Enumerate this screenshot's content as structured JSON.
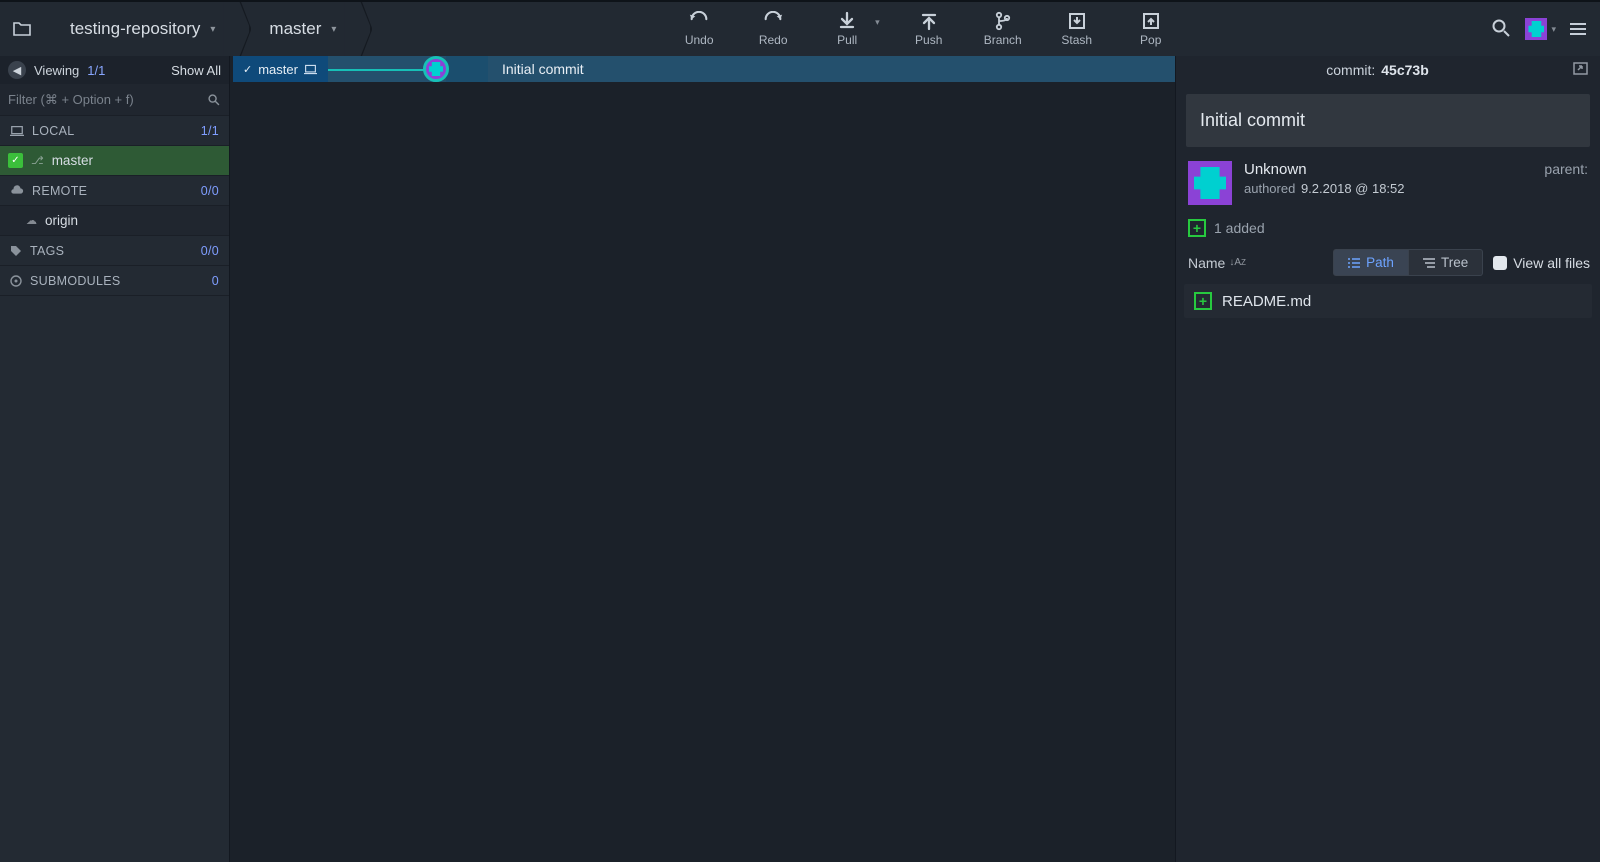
{
  "breadcrumb": {
    "repo": "testing-repository",
    "branch": "master"
  },
  "toolbar": {
    "undo": "Undo",
    "redo": "Redo",
    "pull": "Pull",
    "push": "Push",
    "branch": "Branch",
    "stash": "Stash",
    "pop": "Pop"
  },
  "sidebar": {
    "viewing_label": "Viewing",
    "viewing_count": "1/1",
    "show_all": "Show All",
    "filter_placeholder": "Filter (⌘ + Option + f)",
    "sections": {
      "local": {
        "title": "LOCAL",
        "count": "1/1",
        "items": [
          {
            "name": "master"
          }
        ]
      },
      "remote": {
        "title": "REMOTE",
        "count": "0/0",
        "items": [
          {
            "name": "origin"
          }
        ]
      },
      "tags": {
        "title": "TAGS",
        "count": "0/0"
      },
      "submodules": {
        "title": "SUBMODULES",
        "count": "0"
      }
    }
  },
  "graph": {
    "branch_chip": "master",
    "commit_message": "Initial commit"
  },
  "details": {
    "commit_label": "commit:",
    "commit_hash": "45c73b",
    "title": "Initial commit",
    "author_name": "Unknown",
    "authored_label": "authored",
    "authored_date": "9.2.2018 @ 18:52",
    "parent_label": "parent:",
    "added_text": "1 added",
    "name_sort": "Name",
    "path_btn": "Path",
    "tree_btn": "Tree",
    "view_all": "View all files",
    "files": [
      {
        "name": "README.md"
      }
    ]
  }
}
